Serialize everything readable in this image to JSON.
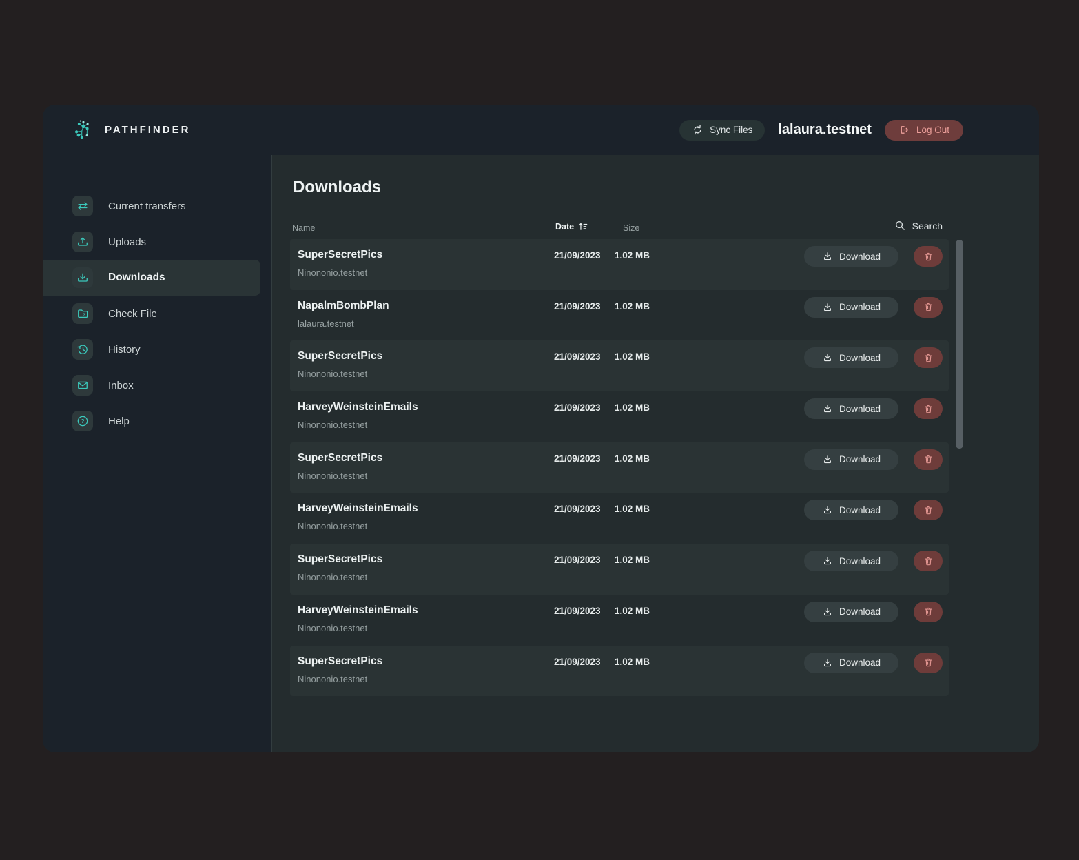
{
  "app": {
    "name": "PATHFINDER"
  },
  "topbar": {
    "sync_label": "Sync Files",
    "username": "lalaura.testnet",
    "logout_label": "Log Out"
  },
  "sidebar": {
    "items": [
      {
        "label": "Current transfers",
        "icon": "transfers-icon",
        "active": false
      },
      {
        "label": "Uploads",
        "icon": "upload-icon",
        "active": false
      },
      {
        "label": "Downloads",
        "icon": "download-icon",
        "active": true
      },
      {
        "label": "Check File",
        "icon": "folder-question-icon",
        "active": false
      },
      {
        "label": "History",
        "icon": "history-icon",
        "active": false
      },
      {
        "label": "Inbox",
        "icon": "envelope-icon",
        "active": false
      },
      {
        "label": "Help",
        "icon": "help-icon",
        "active": false
      }
    ]
  },
  "page": {
    "title": "Downloads"
  },
  "table": {
    "columns": {
      "name": "Name",
      "date": "Date",
      "size": "Size"
    },
    "sort_icon": "sort-ascending-icon",
    "search_label": "Search",
    "download_label": "Download",
    "delete_icon": "trash-icon",
    "rows": [
      {
        "name": "SuperSecretPics",
        "owner": "Ninononio.testnet",
        "date": "21/09/2023",
        "size": "1.02 MB"
      },
      {
        "name": "NapalmBombPlan",
        "owner": "lalaura.testnet",
        "date": "21/09/2023",
        "size": "1.02 MB"
      },
      {
        "name": "SuperSecretPics",
        "owner": "Ninononio.testnet",
        "date": "21/09/2023",
        "size": "1.02 MB"
      },
      {
        "name": "HarveyWeinsteinEmails",
        "owner": "Ninononio.testnet",
        "date": "21/09/2023",
        "size": "1.02 MB"
      },
      {
        "name": "SuperSecretPics",
        "owner": "Ninononio.testnet",
        "date": "21/09/2023",
        "size": "1.02 MB"
      },
      {
        "name": "HarveyWeinsteinEmails",
        "owner": "Ninononio.testnet",
        "date": "21/09/2023",
        "size": "1.02 MB"
      },
      {
        "name": "SuperSecretPics",
        "owner": "Ninononio.testnet",
        "date": "21/09/2023",
        "size": "1.02 MB"
      },
      {
        "name": "HarveyWeinsteinEmails",
        "owner": "Ninononio.testnet",
        "date": "21/09/2023",
        "size": "1.02 MB"
      },
      {
        "name": "SuperSecretPics",
        "owner": "Ninononio.testnet",
        "date": "21/09/2023",
        "size": "1.02 MB"
      }
    ]
  },
  "colors": {
    "accent_teal": "#3bc9bc",
    "danger_button": "#6e3c3a",
    "danger_text": "#eda09b",
    "topbar_bg": "#1b222a",
    "main_bg": "#242c2e",
    "row_alt_bg": "#2a3334"
  }
}
